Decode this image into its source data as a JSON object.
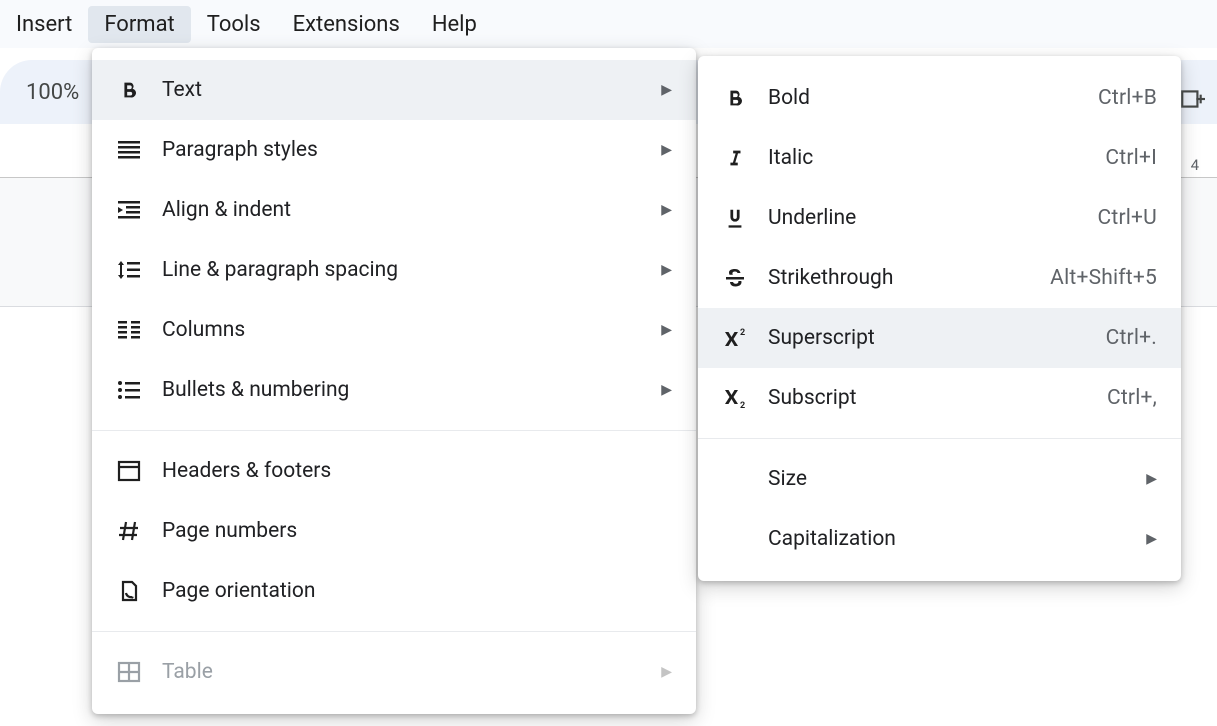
{
  "menubar": {
    "items": [
      "Insert",
      "Format",
      "Tools",
      "Extensions",
      "Help"
    ],
    "activeIndex": 1
  },
  "toolbar": {
    "zoom": "100%"
  },
  "ruler": {
    "tick_right": "4"
  },
  "format_menu": {
    "groups": [
      [
        {
          "icon": "bold",
          "label": "Text",
          "caret": true,
          "highlight": true
        },
        {
          "icon": "paragraph-styles",
          "label": "Paragraph styles",
          "caret": true
        },
        {
          "icon": "align-indent",
          "label": "Align & indent",
          "caret": true
        },
        {
          "icon": "line-spacing",
          "label": "Line & paragraph spacing",
          "caret": true
        },
        {
          "icon": "columns",
          "label": "Columns",
          "caret": true
        },
        {
          "icon": "bullets",
          "label": "Bullets & numbering",
          "caret": true
        }
      ],
      [
        {
          "icon": "headers-footers",
          "label": "Headers & footers"
        },
        {
          "icon": "page-numbers",
          "label": "Page numbers"
        },
        {
          "icon": "page-orientation",
          "label": "Page orientation"
        }
      ],
      [
        {
          "icon": "table",
          "label": "Table",
          "caret": true,
          "disabled": true
        }
      ]
    ]
  },
  "text_submenu": {
    "groups": [
      [
        {
          "icon": "bold",
          "label": "Bold",
          "shortcut": "Ctrl+B"
        },
        {
          "icon": "italic",
          "label": "Italic",
          "shortcut": "Ctrl+I"
        },
        {
          "icon": "underline",
          "label": "Underline",
          "shortcut": "Ctrl+U"
        },
        {
          "icon": "strike",
          "label": "Strikethrough",
          "shortcut": "Alt+Shift+5"
        },
        {
          "icon": "superscript",
          "label": "Superscript",
          "shortcut": "Ctrl+.",
          "highlight": true
        },
        {
          "icon": "subscript",
          "label": "Subscript",
          "shortcut": "Ctrl+,"
        }
      ],
      [
        {
          "label": "Size",
          "caret": true,
          "no_icon": true
        },
        {
          "label": "Capitalization",
          "caret": true,
          "no_icon": true
        }
      ]
    ]
  }
}
